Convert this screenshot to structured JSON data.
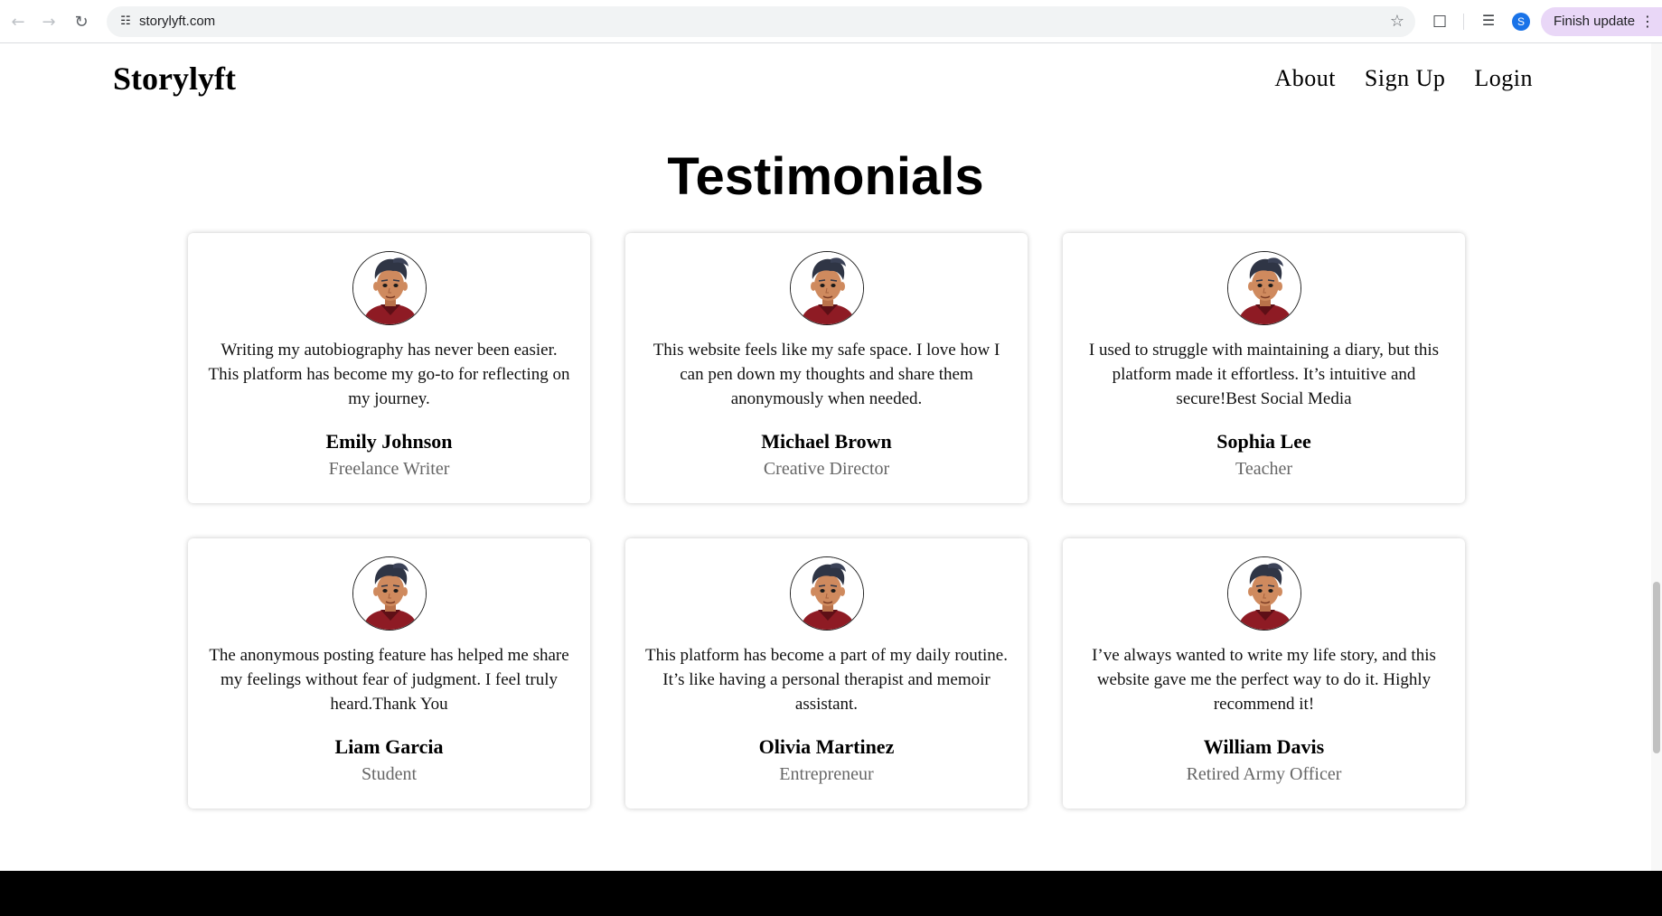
{
  "browser": {
    "url": "storylyft.com",
    "profile_initial": "S",
    "update_label": "Finish update"
  },
  "header": {
    "logo": "Storylyft",
    "nav": [
      "About",
      "Sign Up",
      "Login"
    ]
  },
  "section": {
    "title": "Testimonials"
  },
  "testimonials": [
    {
      "quote": "Writing my autobiography has never been easier. This platform has become my go-to for reflecting on my journey.",
      "name": "Emily Johnson",
      "role": "Freelance Writer"
    },
    {
      "quote": "This website feels like my safe space. I love how I can pen down my thoughts and share them anonymously when needed.",
      "name": "Michael Brown",
      "role": "Creative Director"
    },
    {
      "quote": "I used to struggle with maintaining a diary, but this platform made it effortless. It’s intuitive and secure!Best Social Media",
      "name": "Sophia Lee",
      "role": "Teacher"
    },
    {
      "quote": "The anonymous posting feature has helped me share my feelings without fear of judgment. I feel truly heard.Thank You",
      "name": "Liam Garcia",
      "role": "Student"
    },
    {
      "quote": "This platform has become a part of my daily routine. It’s like having a personal therapist and memoir assistant.",
      "name": "Olivia Martinez",
      "role": "Entrepreneur"
    },
    {
      "quote": "I’ve always wanted to write my life story, and this website gave me the perfect way to do it. Highly recommend it!",
      "name": "William Davis",
      "role": "Retired Army Officer"
    }
  ]
}
